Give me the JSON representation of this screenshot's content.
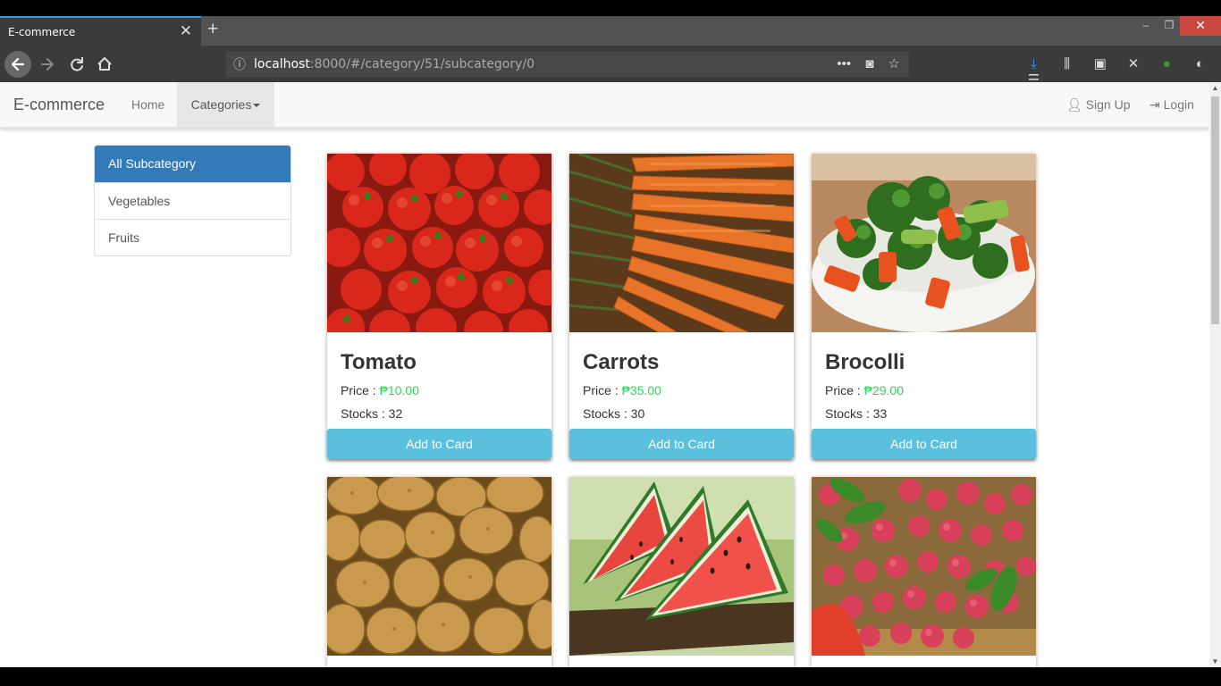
{
  "browser": {
    "tab_title": "E-commerce",
    "tab_close": "✕",
    "new_tab": "+",
    "url_host": "localhost",
    "url_path": ":8000/#/category/51/subcategory/0",
    "window_min": "–",
    "window_max": "❐",
    "window_close": "✕"
  },
  "site": {
    "brand": "E-commerce",
    "nav_home": "Home",
    "nav_categories": "Categories",
    "nav_signup": "Sign Up",
    "nav_login": "Login"
  },
  "sidebar": {
    "items": [
      {
        "label": "All Subcategory",
        "active": true
      },
      {
        "label": "Vegetables",
        "active": false
      },
      {
        "label": "Fruits",
        "active": false
      }
    ]
  },
  "products": [
    {
      "name": "Tomato",
      "price_label": "Price :",
      "price": "₱10.00",
      "stock_label": "Stocks : 32",
      "button": "Add to Card",
      "image": "tomatoes"
    },
    {
      "name": "Carrots",
      "price_label": "Price :",
      "price": "₱35.00",
      "stock_label": "Stocks : 30",
      "button": "Add to Card",
      "image": "carrots"
    },
    {
      "name": "Brocolli",
      "price_label": "Price :",
      "price": "₱29.00",
      "stock_label": "Stocks : 33",
      "button": "Add to Card",
      "image": "broccoli"
    },
    {
      "image": "potatoes"
    },
    {
      "image": "watermelon"
    },
    {
      "image": "lychees"
    }
  ],
  "colors": {
    "accent": "#337ab7",
    "button": "#5bc0de",
    "price": "#2fd35a"
  }
}
